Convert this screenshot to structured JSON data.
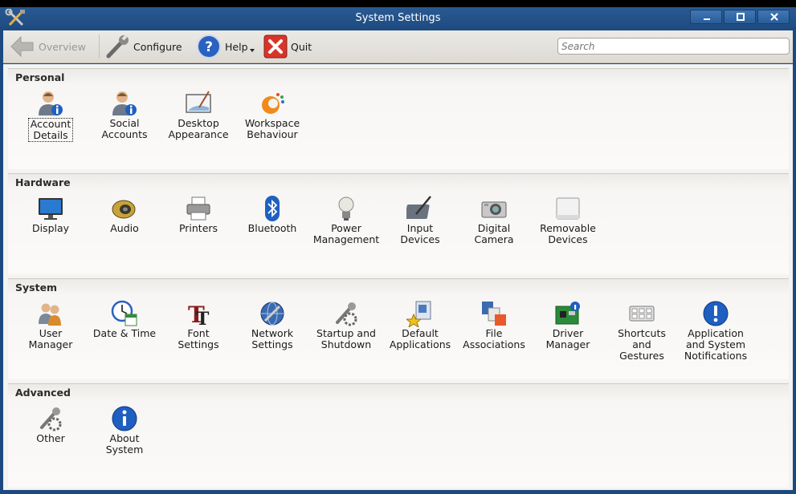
{
  "window": {
    "title": "System Settings"
  },
  "toolbar": {
    "overview_label": "Overview",
    "configure_label": "Configure",
    "help_label": "Help",
    "quit_label": "Quit"
  },
  "search": {
    "placeholder": "Search"
  },
  "sections": {
    "personal": {
      "title": "Personal",
      "items": [
        {
          "line1": "Account",
          "line2": "Details",
          "line3": ""
        },
        {
          "line1": "Social",
          "line2": "Accounts",
          "line3": ""
        },
        {
          "line1": "Desktop",
          "line2": "Appearance",
          "line3": ""
        },
        {
          "line1": "Workspace",
          "line2": "Behaviour",
          "line3": ""
        }
      ]
    },
    "hardware": {
      "title": "Hardware",
      "items": [
        {
          "line1": "Display",
          "line2": "",
          "line3": ""
        },
        {
          "line1": "Audio",
          "line2": "",
          "line3": ""
        },
        {
          "line1": "Printers",
          "line2": "",
          "line3": ""
        },
        {
          "line1": "Bluetooth",
          "line2": "",
          "line3": ""
        },
        {
          "line1": "Power",
          "line2": "Management",
          "line3": ""
        },
        {
          "line1": "Input",
          "line2": "Devices",
          "line3": ""
        },
        {
          "line1": "Digital",
          "line2": "Camera",
          "line3": ""
        },
        {
          "line1": "Removable",
          "line2": "Devices",
          "line3": ""
        }
      ]
    },
    "system": {
      "title": "System",
      "items": [
        {
          "line1": "User",
          "line2": "Manager",
          "line3": ""
        },
        {
          "line1": "Date & Time",
          "line2": "",
          "line3": ""
        },
        {
          "line1": "Font",
          "line2": "Settings",
          "line3": ""
        },
        {
          "line1": "Network",
          "line2": "Settings",
          "line3": ""
        },
        {
          "line1": "Startup and",
          "line2": "Shutdown",
          "line3": ""
        },
        {
          "line1": "Default",
          "line2": "Applications",
          "line3": ""
        },
        {
          "line1": "File",
          "line2": "Associations",
          "line3": ""
        },
        {
          "line1": "Driver",
          "line2": "Manager",
          "line3": ""
        },
        {
          "line1": "Shortcuts",
          "line2": "and",
          "line3": "Gestures"
        },
        {
          "line1": "Application",
          "line2": "and System",
          "line3": "Notifications"
        }
      ]
    },
    "advanced": {
      "title": "Advanced",
      "items": [
        {
          "line1": "Other",
          "line2": "",
          "line3": ""
        },
        {
          "line1": "About",
          "line2": "System",
          "line3": ""
        }
      ]
    }
  },
  "icons": {
    "app": "tools-icon",
    "overview": "back-arrow-icon",
    "configure": "wrench-icon",
    "help": "help-icon",
    "quit": "quit-icon"
  },
  "colors": {
    "titlebar": "#1d4a80",
    "toolbar": "#e3e1dc",
    "content": "#f4f3f1"
  }
}
